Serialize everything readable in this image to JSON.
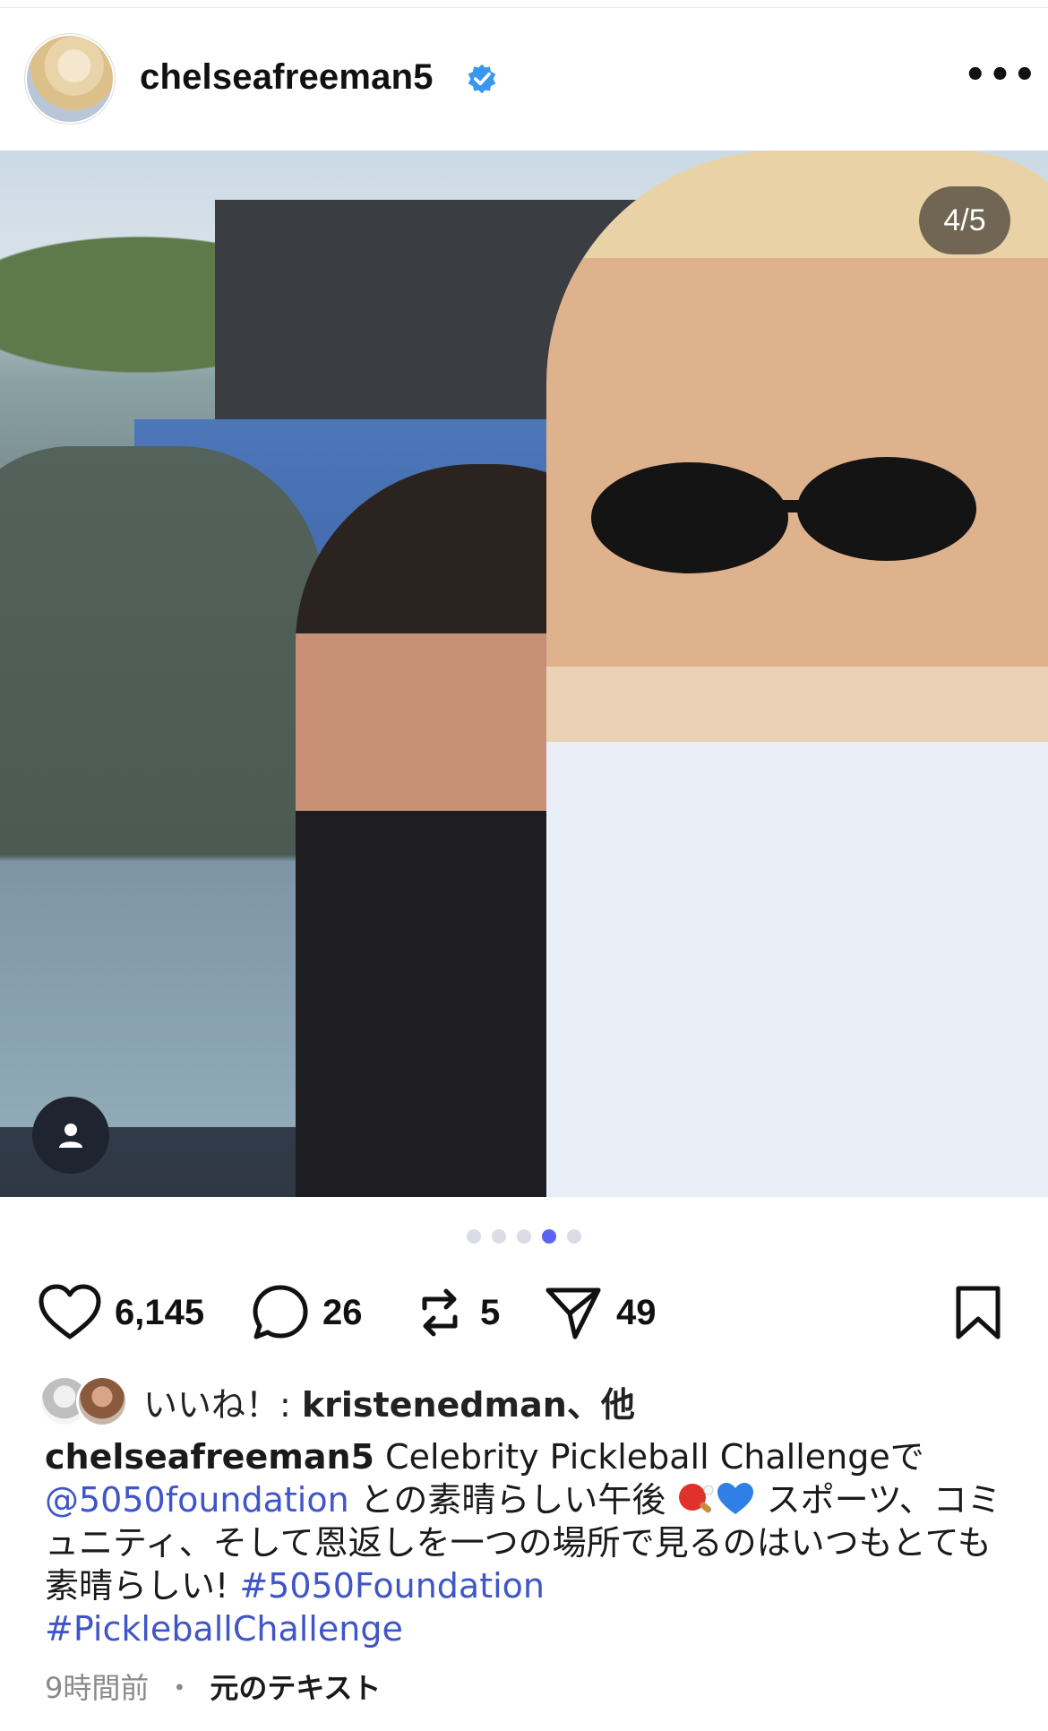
{
  "post": {
    "username": "chelseafreeman5",
    "verified": true,
    "more_label": "•••",
    "photo_counter": "4/5",
    "carousel": {
      "total": 5,
      "active_index": 3
    }
  },
  "actions": {
    "likes": "6,145",
    "comments": "26",
    "reposts": "5",
    "shares": "49"
  },
  "likes_line": {
    "prefix": "いいね！: ",
    "user": "kristenedman",
    "suffix": "、他"
  },
  "caption": {
    "user": "chelseafreeman5",
    "text_1": " Celebrity Pickleball Challengeで",
    "mention": "@5050foundation",
    "text_2": " との素晴らしい午後 ",
    "text_3": " スポーツ、コミュニティ、そして恩返しを一つの場所で見るのはいつもとても素晴らしい! ",
    "hashtag_1": "#5050Foundation",
    "hashtag_2": "#PickleballChallenge"
  },
  "footer": {
    "time": "9時間前",
    "separator": "・",
    "original_text": "元のテキスト"
  },
  "icons": {
    "verified_badge_color": "#3897f0",
    "active_dot_color": "#5a64f0",
    "link_color": "#3f55c8"
  }
}
